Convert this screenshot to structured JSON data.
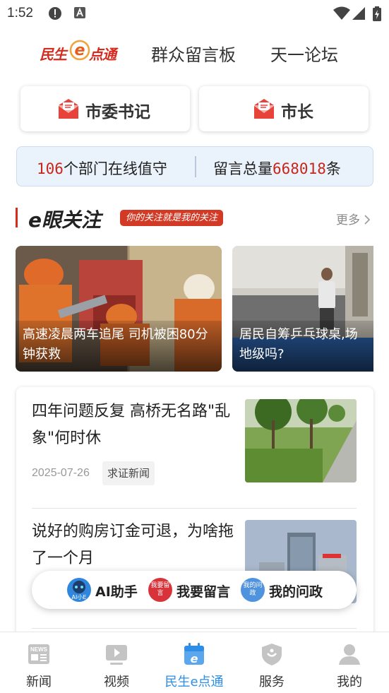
{
  "status_bar": {
    "time": "1:52",
    "icons": [
      "alert-circle-icon",
      "font-a-icon",
      "wifi-icon",
      "signal-icon",
      "battery-icon"
    ]
  },
  "top_tabs": {
    "brand_prefix": "民生",
    "brand_suffix": "点通",
    "tabs": [
      "群众留言板",
      "天一论坛"
    ]
  },
  "leaders": [
    {
      "label": "市委书记",
      "icon": "mail-icon"
    },
    {
      "label": "市长",
      "icon": "mail-icon"
    }
  ],
  "stats": {
    "dept_count": "106",
    "dept_text": "个部门在线值守",
    "total_prefix": "留言总量",
    "total_count": "668018",
    "total_suffix": "条"
  },
  "section": {
    "title": "e眼关注",
    "tag": "你的关注就是我的关注",
    "more": "更多"
  },
  "photo_news": [
    {
      "title": "高速凌晨两车追尾 司机被困80分钟获救"
    },
    {
      "title": "居民自筹乒乓球桌,场地级吗?"
    }
  ],
  "articles": [
    {
      "title": "四年问题反复 高桥无名路\"乱象\"何时休",
      "date": "2025-07-26",
      "tag": "求证新闻"
    },
    {
      "title": "说好的购房订金可退，为啥拖了一个月"
    }
  ],
  "fab": {
    "items": [
      {
        "label": "AI助手",
        "icon_text": "AI小E",
        "color": "#2f86dc"
      },
      {
        "label": "我要留言",
        "icon_text": "我要留言",
        "color": "#d8323a"
      },
      {
        "label": "我的问政",
        "icon_text": "我的问政",
        "color": "#4f93df"
      }
    ]
  },
  "bottom_nav": {
    "items": [
      {
        "label": "新闻",
        "icon": "news-icon"
      },
      {
        "label": "视频",
        "icon": "video-icon"
      },
      {
        "label": "民生e点通",
        "icon": "calendar-e-icon",
        "active": true
      },
      {
        "label": "服务",
        "icon": "shield-icon"
      },
      {
        "label": "我的",
        "icon": "user-icon"
      }
    ]
  },
  "colors": {
    "brand_red": "#d52b1e",
    "accent_blue": "#2e8de6",
    "stats_bg": "#eaf2fb"
  }
}
